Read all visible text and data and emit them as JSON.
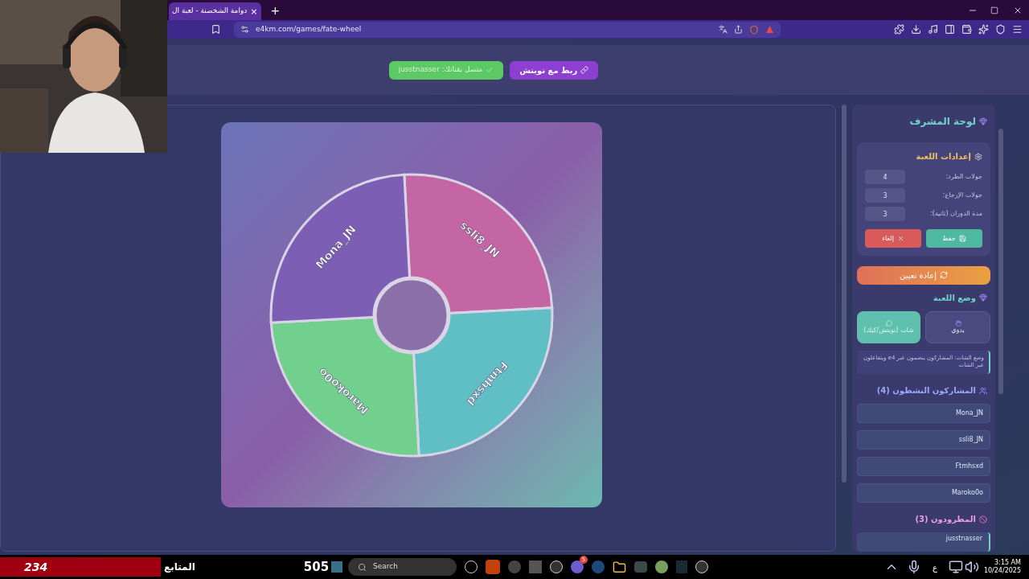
{
  "browser": {
    "tab": {
      "title": "دوامة الشخصنة - لعبة ال",
      "close": "×"
    },
    "new_tab": "+",
    "address": "e4km.com/games/fate-wheel"
  },
  "header": {
    "connected": "متصل بقناتك: jusstnasser",
    "twitch": "ربط مع تويتش"
  },
  "wheel": {
    "segments": [
      {
        "name": "ssli8_JN",
        "color": "#c466a4"
      },
      {
        "name": "Ftmhsxd",
        "color": "#5fbfc4"
      },
      {
        "name": "Maroko0o",
        "color": "#72d08f"
      },
      {
        "name": "Mona_JN",
        "color": "#7c5fb4"
      }
    ]
  },
  "panel": {
    "title": "لوحة المشرف",
    "settings": {
      "title": "إعدادات اللعبة",
      "fields": [
        {
          "label": "جولات الطرد:",
          "value": "4"
        },
        {
          "label": "جولات الإرجاع:",
          "value": "3"
        },
        {
          "label": "مدة الدوران (ثانية):",
          "value": "3"
        }
      ],
      "save": "حفظ",
      "cancel": "إلغاء"
    },
    "reset": "إعادة تعيين",
    "mode": {
      "title": "وضع اللعبة",
      "options": [
        {
          "label": "يدوي",
          "selected": false
        },
        {
          "label": "شات (تويتش/كيك)",
          "selected": true
        }
      ],
      "note": "وضع الشات: المشاركون ينضمون عبر e4 ويتفاعلون عبر الشات"
    },
    "active": {
      "title": "المشاركون النشطون (4)",
      "players": [
        "Mona_JN",
        "ssli8_JN",
        "Ftmhsxd",
        "Maroko0o"
      ]
    },
    "eliminated": {
      "title": "المطرودون (3)",
      "players": [
        "jusstnasser"
      ]
    }
  },
  "overlay": {
    "followers": "234",
    "followers_label": "المتابع",
    "count": "505"
  },
  "taskbar": {
    "search": "Search",
    "discord_badge": "5",
    "language": "ع",
    "time": "3:15 AM",
    "date": "10/24/2025"
  }
}
